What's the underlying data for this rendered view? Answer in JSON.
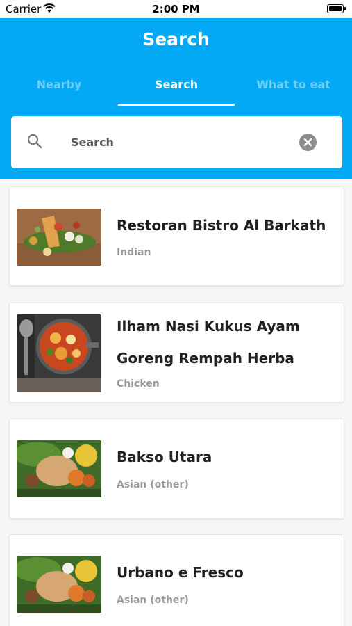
{
  "status_bar": {
    "carrier": "Carrier",
    "time": "2:00 PM"
  },
  "header": {
    "title": "Search"
  },
  "tabs": [
    {
      "label": "Nearby",
      "active": false
    },
    {
      "label": "Search",
      "active": true
    },
    {
      "label": "What to eat",
      "active": false
    }
  ],
  "search": {
    "placeholder": "Search",
    "value": ""
  },
  "colors": {
    "accent": "#03a9f4",
    "background": "#f6f6f6"
  },
  "results": [
    {
      "name": "Restoran Bistro Al Barkath",
      "category": "Indian",
      "image": "indian-thali-photo"
    },
    {
      "name": "Ilham Nasi Kukus Ayam Goreng Rempah Herba",
      "category": "Chicken",
      "image": "chicken-curry-pot-photo"
    },
    {
      "name": "Bakso Utara",
      "category": "Asian (other)",
      "image": "nasi-platter-photo"
    },
    {
      "name": "Urbano e Fresco",
      "category": "Asian (other)",
      "image": "nasi-platter-photo"
    }
  ]
}
